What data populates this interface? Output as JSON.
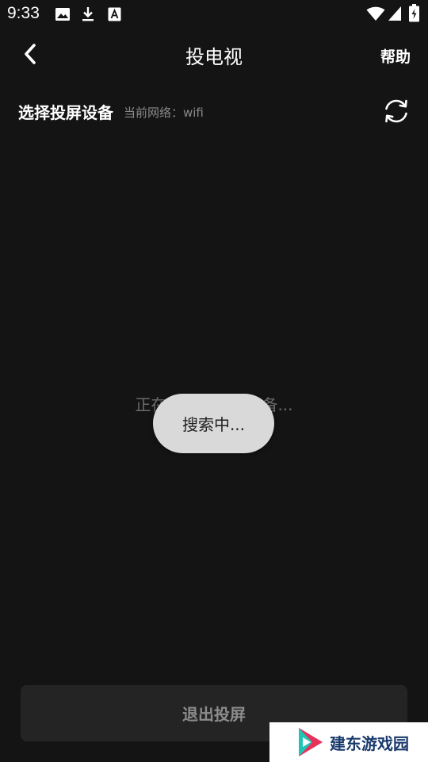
{
  "status_bar": {
    "time": "9:33",
    "left_icons": [
      "image-icon",
      "download-icon",
      "font-icon"
    ],
    "right_icons": [
      "wifi-icon",
      "signal-icon",
      "battery-charging-icon"
    ]
  },
  "header": {
    "back_icon": "chevron-left-icon",
    "title": "投电视",
    "help_label": "帮助"
  },
  "section": {
    "title": "选择投屏设备",
    "network_label": "当前网络：wifi",
    "refresh_icon": "refresh-icon"
  },
  "main": {
    "searching_text": "正在搜索可连接设备...",
    "toast_text": "搜索中..."
  },
  "footer": {
    "exit_label": "退出投屏"
  },
  "watermark": {
    "text": "建东游戏园"
  },
  "colors": {
    "background": "#141414",
    "button_bg": "#242424",
    "toast_bg": "#d9d9d9",
    "muted_text": "#8a8a8a"
  }
}
